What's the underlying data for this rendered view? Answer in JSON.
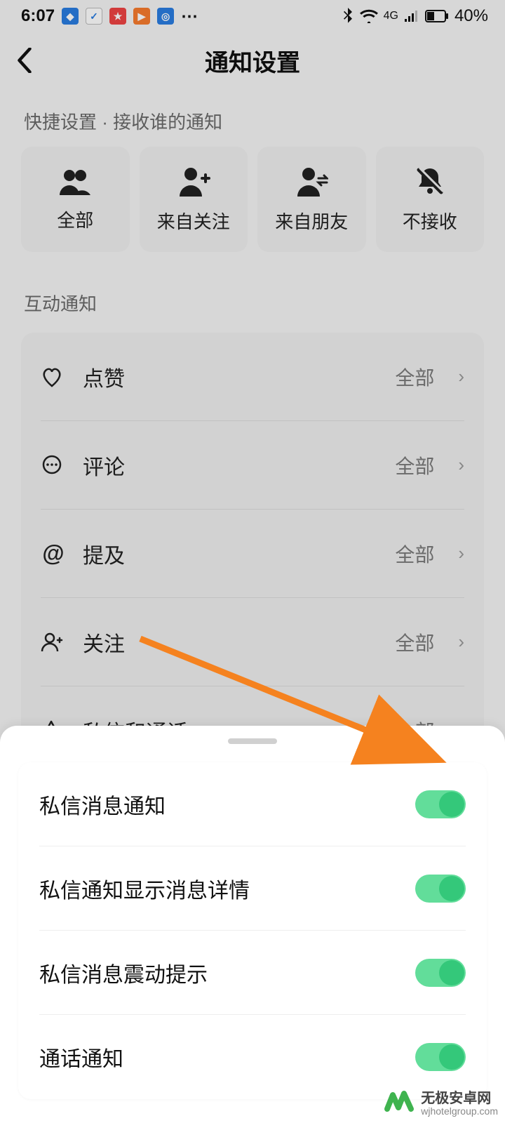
{
  "status": {
    "time": "6:07",
    "battery": "40%",
    "net_label": "4G"
  },
  "header": {
    "title": "通知设置"
  },
  "quick": {
    "heading": "快捷设置 · 接收谁的通知",
    "items": [
      {
        "label": "全部",
        "icon": "people"
      },
      {
        "label": "来自关注",
        "icon": "person-add"
      },
      {
        "label": "来自朋友",
        "icon": "person-swap"
      },
      {
        "label": "不接收",
        "icon": "bell-off"
      }
    ]
  },
  "interact": {
    "heading": "互动通知",
    "value_all": "全部",
    "items": [
      {
        "label": "点赞",
        "icon": "heart"
      },
      {
        "label": "评论",
        "icon": "chat"
      },
      {
        "label": "提及",
        "icon": "at"
      },
      {
        "label": "关注",
        "icon": "person-plus"
      },
      {
        "label": "私信和通话",
        "icon": "send"
      }
    ]
  },
  "sheet": {
    "items": [
      {
        "label": "私信消息通知",
        "on": true
      },
      {
        "label": "私信通知显示消息详情",
        "on": true
      },
      {
        "label": "私信消息震动提示",
        "on": true
      },
      {
        "label": "通话通知",
        "on": true
      }
    ]
  },
  "watermark": {
    "cn": "无极安卓网",
    "en": "wjhotelgroup.com"
  },
  "colors": {
    "toggle_track": "#62dd9a",
    "toggle_knob": "#34c87a",
    "arrow": "#f5821f"
  }
}
